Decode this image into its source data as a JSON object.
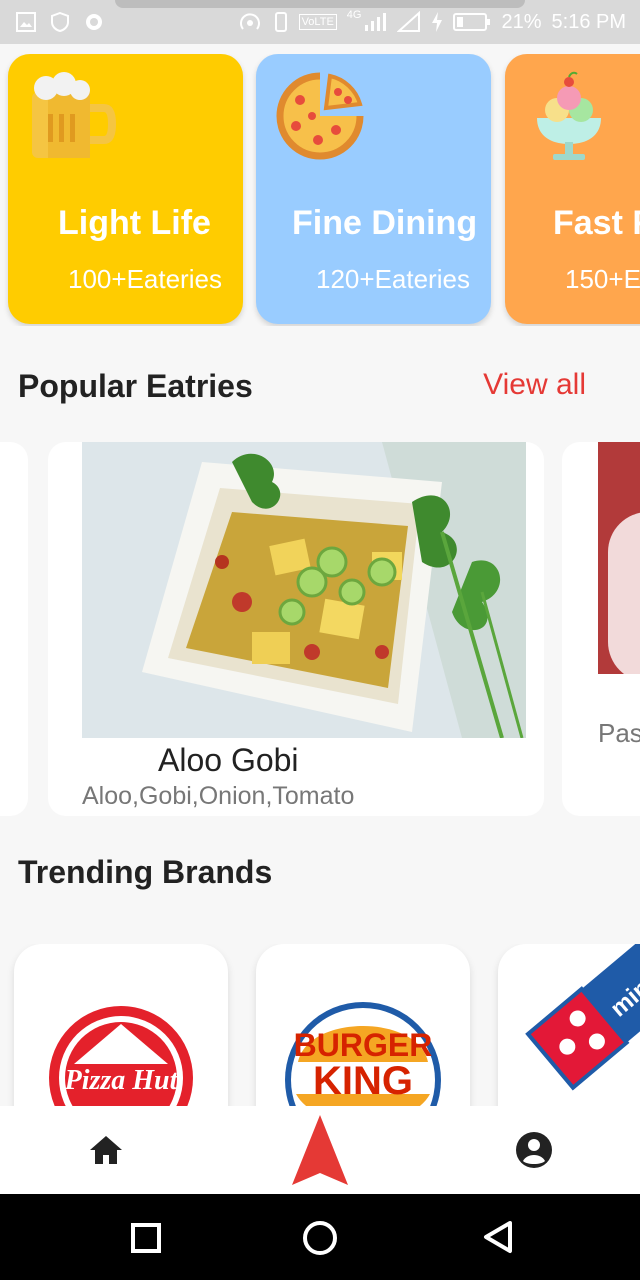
{
  "status_bar": {
    "network": "4G",
    "volte": "VoLTE",
    "battery": "21%",
    "time": "5:16 PM"
  },
  "categories": [
    {
      "title": "Light Life",
      "subtitle": "100+Eateries",
      "color": "#FFCC00",
      "icon": "beer-mug-icon"
    },
    {
      "title": "Fine Dining",
      "subtitle": "120+Eateries",
      "color": "#99CCFF",
      "icon": "pizza-icon"
    },
    {
      "title": "Fast F",
      "subtitle": "150+E",
      "color": "#FFA64D",
      "icon": "ice-cream-sundae-icon"
    }
  ],
  "popular": {
    "title": "Popular Eatries",
    "view_all": "View all",
    "items": [
      {
        "name": "Aloo Gobi",
        "ingredients": "Aloo,Gobi,Onion,Tomato"
      },
      {
        "name": "",
        "ingredients": "Pas"
      }
    ]
  },
  "trending": {
    "title": "Trending Brands",
    "brands": [
      {
        "name": "Pizza Hut",
        "logo_text": "Pizza Hut",
        "color": "#E4212B"
      },
      {
        "name": "Burger King",
        "logo_text_1": "BURGER",
        "logo_text_2": "KING",
        "color": "#D62300"
      },
      {
        "name": "Domino's",
        "logo_text": "mino",
        "color": "#E31837"
      }
    ]
  },
  "bottom_nav": {
    "home": "home-icon",
    "center": "navigation-arrow-icon",
    "profile": "account-circle-icon"
  },
  "accent_color": "#E53935"
}
